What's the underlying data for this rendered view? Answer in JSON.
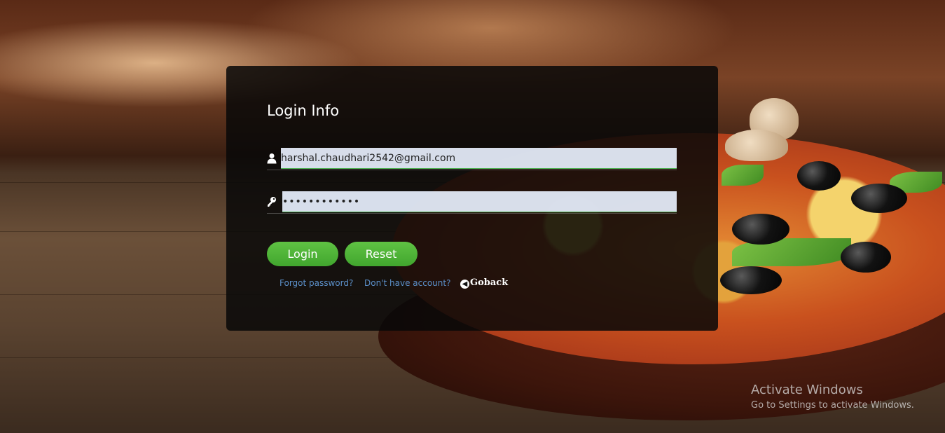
{
  "login": {
    "title": "Login Info",
    "email_value": "harshal.chaudhari2542@gmail.com",
    "password_value": "••••••••••••",
    "login_label": "Login",
    "reset_label": "Reset",
    "forgot_label": "Forgot password?",
    "signup_label": "Don't have account?",
    "goback_label": "Goback"
  },
  "watermark": {
    "title": "Activate Windows",
    "subtitle": "Go to Settings to activate Windows."
  },
  "icons": {
    "email": "user-icon",
    "password": "key-icon",
    "goback": "arrow-left-circle-icon"
  },
  "colors": {
    "button": "#4caf3a",
    "link": "#5b8fc8",
    "card": "#080808"
  }
}
